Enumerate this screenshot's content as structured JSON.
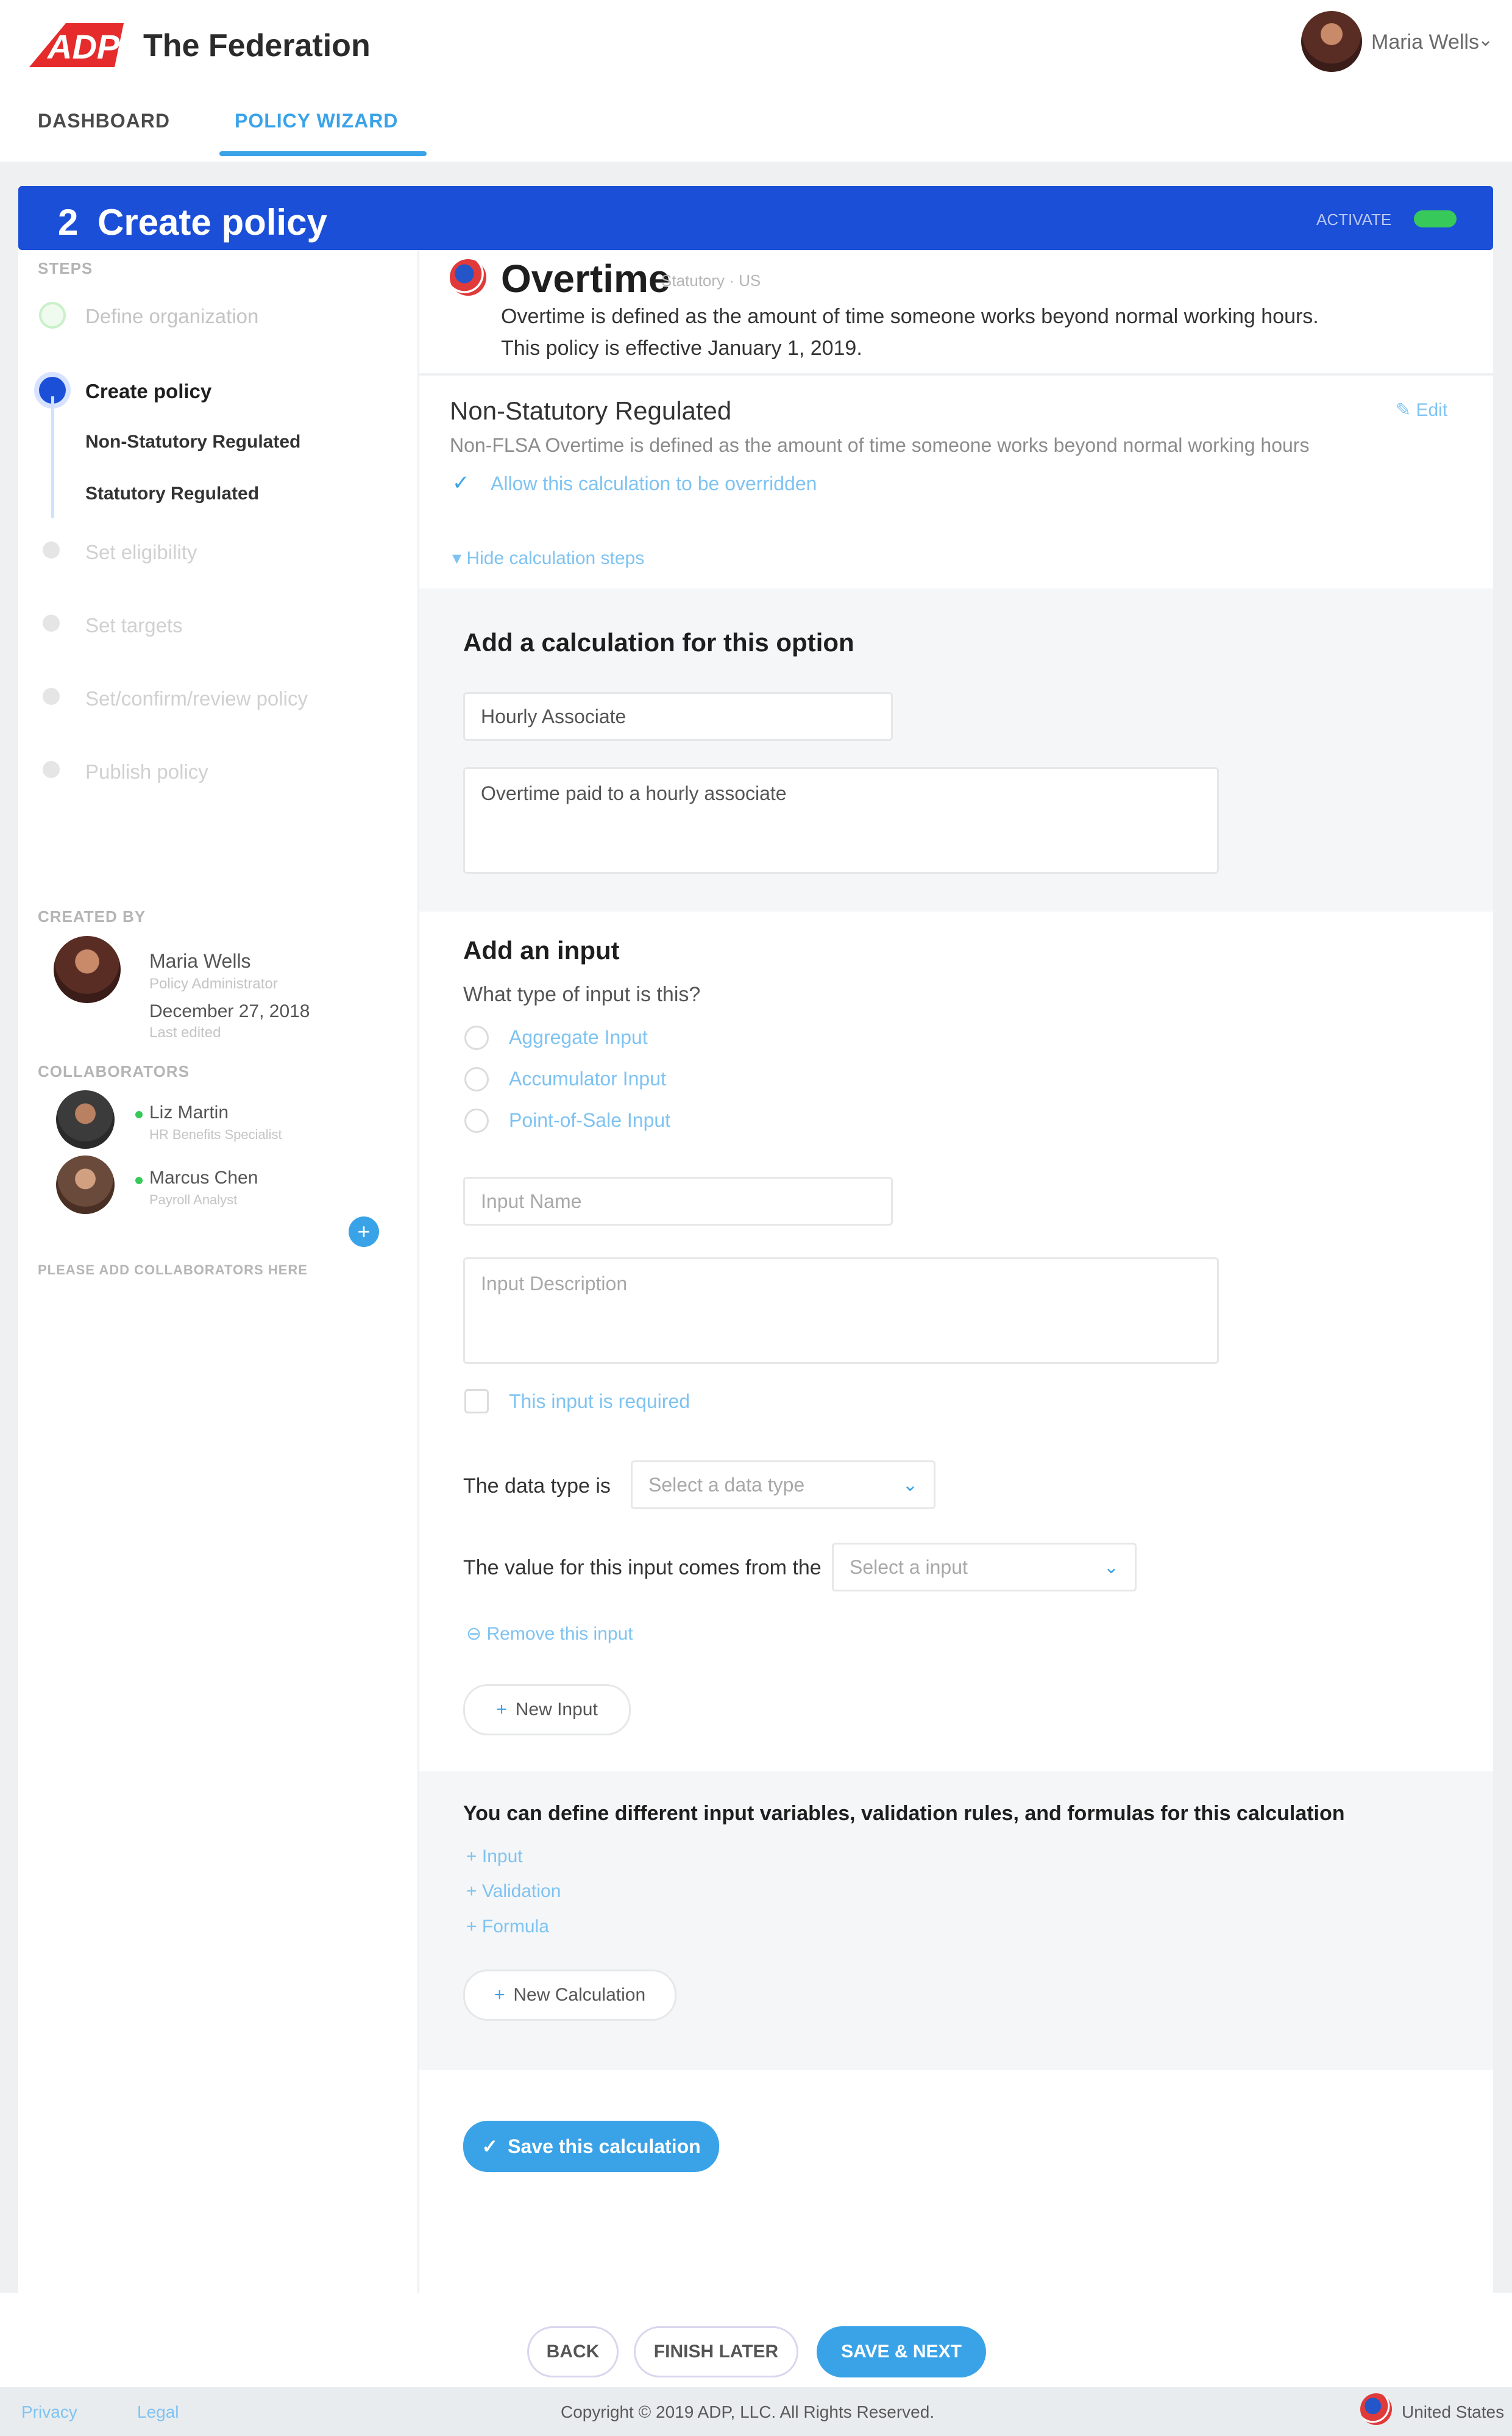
{
  "header": {
    "org_name": "The Federation",
    "user_name": "Maria Wells",
    "user_caret": "⌄",
    "tabs": [
      {
        "label": "DASHBOARD"
      },
      {
        "label": "POLICY WIZARD"
      }
    ]
  },
  "banner": {
    "step_number": "2",
    "title": "Create policy",
    "status_label": "ACTIVATE"
  },
  "sidebar": {
    "steps_label": "STEPS",
    "steps": [
      {
        "label": "Define organization"
      },
      {
        "label": "Create policy"
      },
      {
        "label": "Non-Statutory Regulated"
      },
      {
        "label": "Statutory Regulated"
      },
      {
        "label": "Set eligibility"
      },
      {
        "label": "Set targets"
      },
      {
        "label": "Set/confirm/review policy"
      },
      {
        "label": "Publish policy"
      }
    ],
    "created_by_label": "CREATED BY",
    "creator": {
      "name": "Maria Wells",
      "role": "Policy Administrator",
      "date": "December 27, 2018",
      "date_sub": "Last edited"
    },
    "collaborators_label": "COLLABORATORS",
    "collaborators": [
      {
        "name": "Liz Martin",
        "role": "HR Benefits Specialist"
      },
      {
        "name": "Marcus Chen",
        "role": "Payroll Analyst"
      }
    ],
    "add_icon": "+",
    "hint": "PLEASE ADD COLLABORATORS HERE"
  },
  "policy": {
    "title": "Overtime",
    "tag": "Statutory · US",
    "description": "Overtime is defined as the amount of time someone works beyond normal working hours.",
    "effective": "This policy is effective January 1, 2019."
  },
  "option": {
    "title": "Non-Statutory Regulated",
    "description": "Non-FLSA Overtime is defined as the amount of time someone works beyond normal working hours",
    "allow_label": "Allow this calculation to be overridden",
    "edit_label": "Edit",
    "toggle_label": "Hide calculation steps"
  },
  "calculation": {
    "heading": "Add a calculation for this option",
    "name_value": "Hourly Associate",
    "description_value": "Overtime paid to a hourly associate"
  },
  "input": {
    "heading": "Add an input",
    "question": "What type of input is this?",
    "types": [
      {
        "label": "Aggregate Input"
      },
      {
        "label": "Accumulator Input"
      },
      {
        "label": "Point-of-Sale Input"
      }
    ],
    "name_placeholder": "Input Name",
    "description_placeholder": "Input Description",
    "required_label": "This input is required",
    "data_type_label": "The data type is",
    "data_type_placeholder": "Select a data type",
    "source_label": "The value for this input comes from the",
    "source_placeholder": "Select a input",
    "remove_label": "Remove this input",
    "new_input_label": "New Input"
  },
  "variables": {
    "heading": "You can define different input variables, validation rules, and formulas for this calculation",
    "links": [
      {
        "label": "Input"
      },
      {
        "label": "Validation"
      },
      {
        "label": "Formula"
      }
    ],
    "new_calc_label": "New Calculation"
  },
  "save_calc_label": "Save this calculation",
  "footer": {
    "back": "BACK",
    "later": "FINISH LATER",
    "next": "SAVE & NEXT",
    "links": [
      {
        "label": "Privacy"
      },
      {
        "label": "Legal"
      }
    ],
    "copyright": "Copyright © 2019 ADP, LLC. All Rights Reserved.",
    "language": "United States"
  },
  "colors": {
    "brand_red": "#e52b2b",
    "banner_blue": "#1c4fd8",
    "accent_blue": "#3aa3e8",
    "active_green": "#37c95a"
  },
  "icons": {
    "check": "✓",
    "plus": "+",
    "caret": "⌄",
    "edit": "✎",
    "remove": "⊖",
    "collapse": "▾"
  }
}
